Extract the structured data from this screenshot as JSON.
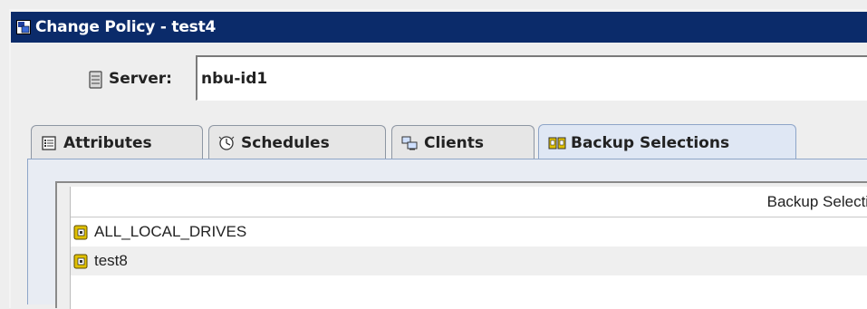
{
  "window": {
    "title": "Change Policy - test4"
  },
  "server": {
    "label": "Server:",
    "value": "nbu-id1"
  },
  "tabs": [
    {
      "label": "Attributes",
      "icon": "attributes-icon",
      "active": false
    },
    {
      "label": "Schedules",
      "icon": "schedules-icon",
      "active": false
    },
    {
      "label": "Clients",
      "icon": "clients-icon",
      "active": false
    },
    {
      "label": "Backup Selections",
      "icon": "backup-selections-icon",
      "active": true
    }
  ],
  "selections": {
    "column_header": "Backup Selection",
    "rows": [
      {
        "name": "ALL_LOCAL_DRIVES",
        "icon": "backup-item-icon"
      },
      {
        "name": "test8",
        "icon": "backup-item-icon"
      }
    ]
  },
  "colors": {
    "titlebar": "#0b2b6a",
    "active_tab": "#dfe7f4",
    "item_icon": "#e0c000"
  }
}
